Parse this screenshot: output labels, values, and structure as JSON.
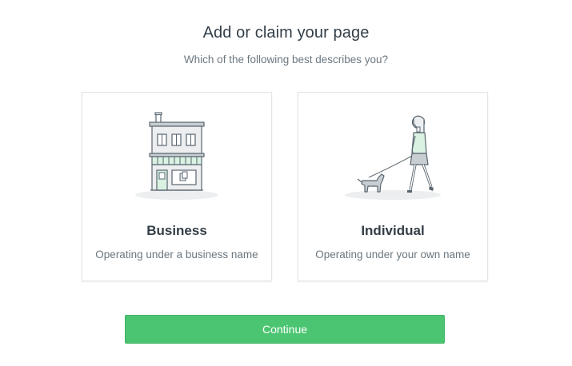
{
  "header": {
    "title": "Add or claim your page",
    "subtitle": "Which of the following best describes you?"
  },
  "options": [
    {
      "title": "Business",
      "description": "Operating under a business name",
      "illustration": "storefront-building-icon"
    },
    {
      "title": "Individual",
      "description": "Operating under your own name",
      "illustration": "person-walking-dog-icon"
    }
  ],
  "actions": {
    "continue_label": "Continue"
  },
  "colors": {
    "accent": "#4cc572",
    "accent_light": "#d9f2e2",
    "outline": "#5a6670",
    "shadow": "#eceeef"
  }
}
